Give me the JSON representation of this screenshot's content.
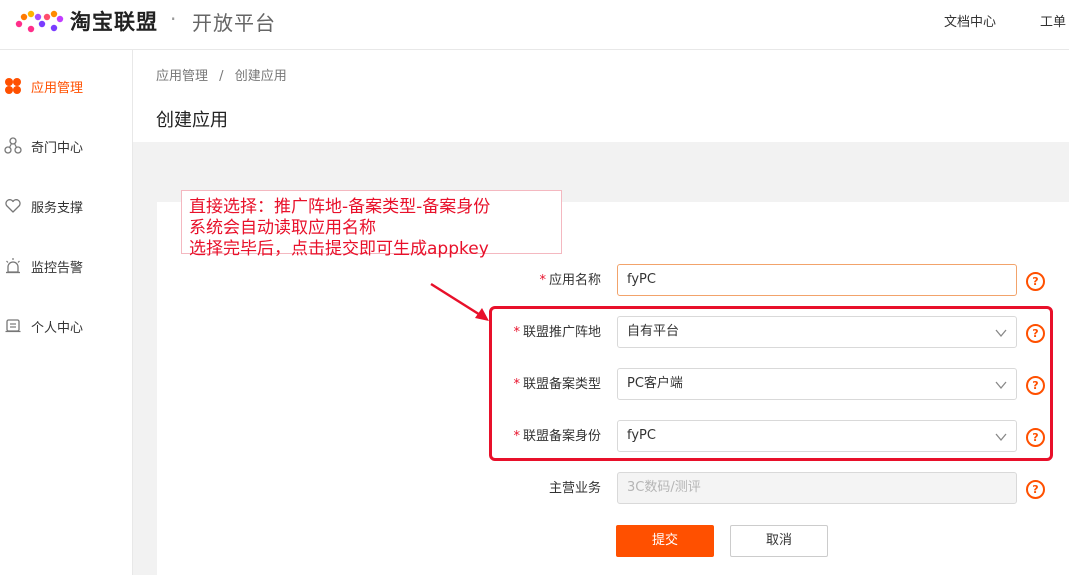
{
  "header": {
    "brand": "淘宝联盟",
    "separator": "·",
    "subtitle": "开放平台",
    "links": [
      "文档中心",
      "工单"
    ]
  },
  "sidebar": {
    "items": [
      {
        "label": "应用管理",
        "icon": "app-grid-icon",
        "active": true
      },
      {
        "label": "奇门中心",
        "icon": "network-icon",
        "active": false
      },
      {
        "label": "服务支撑",
        "icon": "heart-icon",
        "active": false
      },
      {
        "label": "监控告警",
        "icon": "alarm-light-icon",
        "active": false
      },
      {
        "label": "个人中心",
        "icon": "profile-card-icon",
        "active": false
      }
    ]
  },
  "breadcrumb": {
    "parent": "应用管理",
    "separator": "/",
    "current": "创建应用"
  },
  "page_title": "创建应用",
  "annotation": {
    "lines": [
      "直接选择：推广阵地-备案类型-备案身份",
      "系统会自动读取应用名称",
      "选择完毕后，点击提交即可生成appkey"
    ]
  },
  "form": {
    "required_mark": "*",
    "app_name": {
      "label": "应用名称",
      "value": "fyPC"
    },
    "promo_site": {
      "label": "联盟推广阵地",
      "value": "自有平台"
    },
    "record_type": {
      "label": "联盟备案类型",
      "value": "PC客户端"
    },
    "record_identity": {
      "label": "联盟备案身份",
      "value": "fyPC"
    },
    "main_business": {
      "label": "主营业务",
      "placeholder": "3C数码/测评"
    },
    "help_symbol": "?",
    "submit_label": "提交",
    "cancel_label": "取消"
  },
  "colors": {
    "accent": "#ff5000",
    "annotation": "#e8102a"
  }
}
